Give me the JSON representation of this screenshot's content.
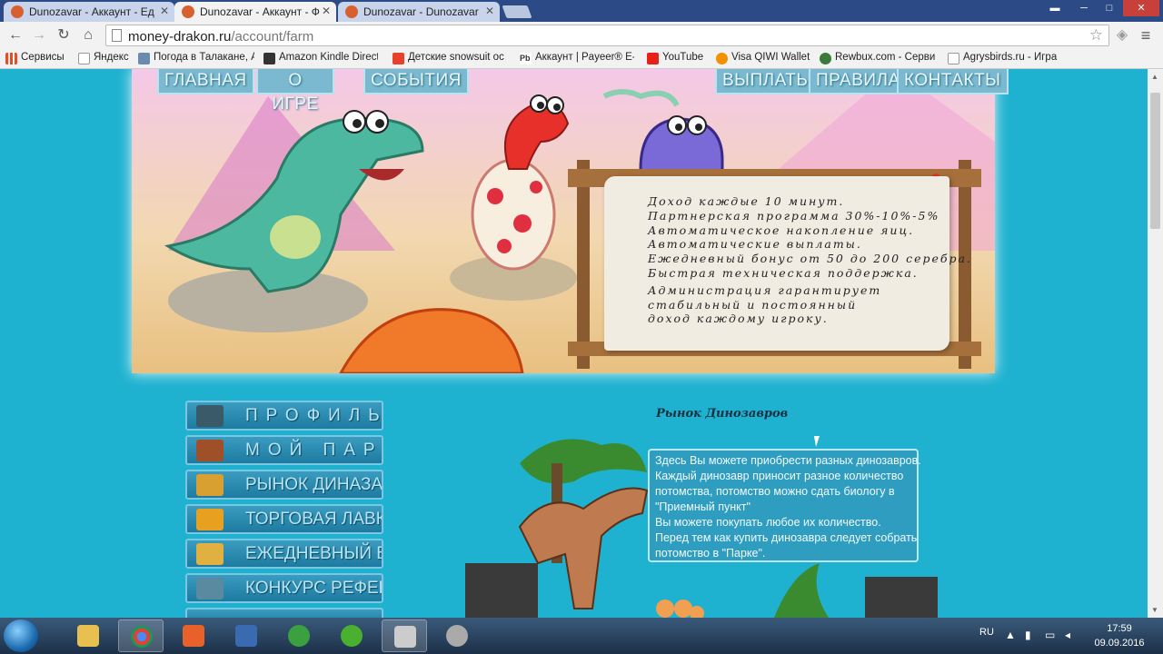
{
  "browser": {
    "tabs": [
      {
        "label": "Dunozavar - Аккаунт - Ед"
      },
      {
        "label": "Dunozavar - Аккаунт - Ф"
      },
      {
        "label": "Dunozavar - Dunozavar"
      }
    ],
    "address": {
      "domain": "money-drakon.ru",
      "path": "/account/farm"
    },
    "bookmarks": [
      {
        "label": "Сервисы",
        "color": "#e44d26"
      },
      {
        "label": "Яндекс",
        "color": "#ffffff"
      },
      {
        "label": "Погода в Талакане, А",
        "color": "#6a8ab0"
      },
      {
        "label": "Amazon Kindle Direct",
        "color": "#333333"
      },
      {
        "label": "Детские snowsuit ос",
        "color": "#e8402a"
      },
      {
        "label": "Аккаунт | Payeer® E-",
        "color": "#ffffff"
      },
      {
        "label": "YouTube",
        "color": "#e62117"
      },
      {
        "label": "Visa QIWI Wallet",
        "color": "#f29100"
      },
      {
        "label": "Rewbux.com - Серви",
        "color": "#3a7a3a"
      },
      {
        "label": "Agrysbirds.ru - Игра",
        "color": "#ffffff"
      }
    ]
  },
  "site": {
    "nav": [
      "ГЛАВНАЯ",
      "О ИГРЕ",
      "СОБЫТИЯ",
      "ВЫПЛАТЫ",
      "ПРАВИЛА",
      "КОНТАКТЫ"
    ],
    "scroll_lines": [
      "Доход каждые 10 минут.",
      "Партнерская программа 30%-10%-5%",
      "Автоматическое накопление яиц.",
      "Автоматические выплаты.",
      "Ежедневный бонус от 50 до 200 серебра.",
      "Быстрая техническая поддержка.",
      "Администрация гарантирует",
      "стабильный и постоянный",
      "доход каждому игроку."
    ],
    "menu": [
      "ПРОФИЛЬ",
      "МОЙ ПАРК",
      "РЫНОК ДИНАЗАВРОВ",
      "ТОРГОВАЯ ЛАВКА",
      "ЕЖЕДНЕВНЫЙ БОНУС",
      "КОНКУРС РЕФЕРАЛОВ"
    ],
    "market_title": "Рынок Динозавров",
    "info_lines": [
      "Здесь Вы можете приобрести разных динозавров.",
      "Каждый динозавр приносит разное количество",
      "потомства, потомство можно сдать биологу в",
      "\"Приемный пункт\"",
      "Вы можете покупать любое их количество.",
      "Перед тем как купить динозавра следует собрать",
      "потомство в \"Парке\"."
    ]
  },
  "taskbar": {
    "language": "RU",
    "time": "17:59",
    "date": "09.09.2016"
  },
  "colors": {
    "page_bg": "#1eb2d0",
    "menu_button": "#1e7aa0",
    "info_box": "#2f9dbf"
  }
}
